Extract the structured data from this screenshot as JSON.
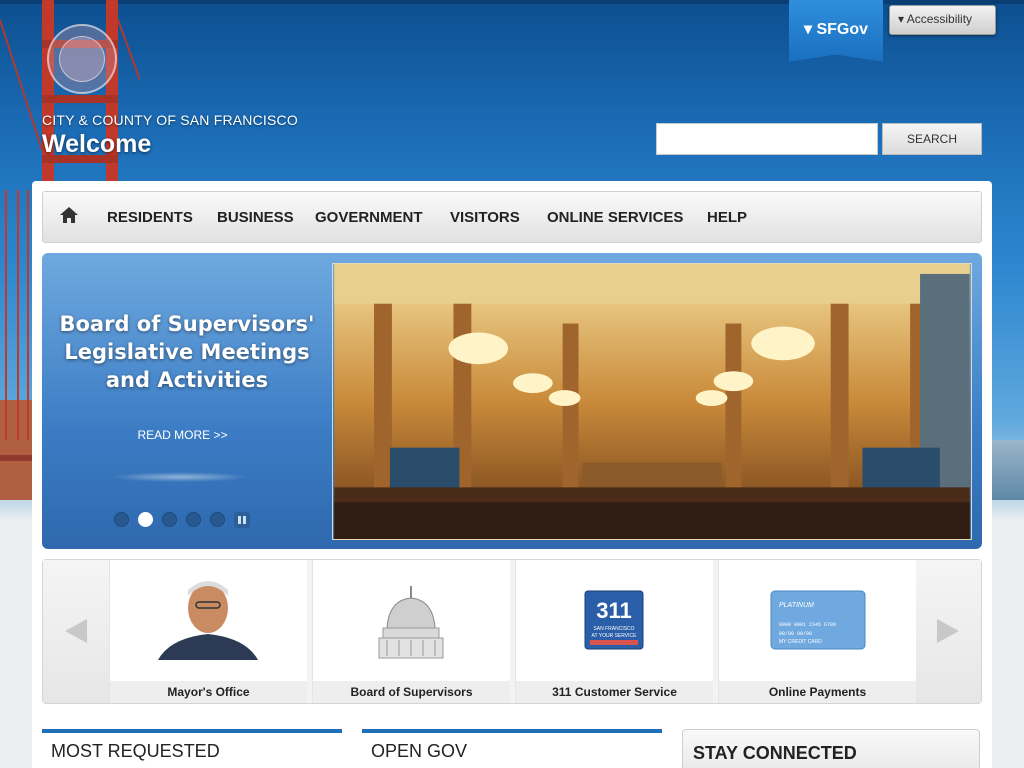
{
  "header": {
    "city_name": "CITY & COUNTY OF SAN FRANCISCO",
    "welcome": "Welcome",
    "sfgov_label": "▾ SFGov",
    "accessibility_label": "▾ Accessibility",
    "search": {
      "value": "",
      "placeholder": "",
      "button_label": "SEARCH"
    }
  },
  "nav": {
    "home_icon": "home-icon",
    "items": [
      "RESIDENTS",
      "BUSINESS",
      "GOVERNMENT",
      "VISITORS",
      "ONLINE SERVICES",
      "HELP"
    ]
  },
  "hero": {
    "title_line1": "Board of Supervisors'",
    "title_line2": "Legislative Meetings",
    "title_line3": "and Activities",
    "read_more": "READ MORE >>",
    "slide_count": 5,
    "active_slide": 2,
    "pause_icon": "pause-icon"
  },
  "quick_links": [
    {
      "label": "Mayor's Office",
      "icon": "mayor-portrait"
    },
    {
      "label": "Board of Supervisors",
      "icon": "city-hall-dome"
    },
    {
      "label": "311 Customer Service",
      "icon": "311-logo"
    },
    {
      "label": "Online Payments",
      "icon": "credit-card"
    }
  ],
  "logo_311": {
    "number": "311",
    "sub1": "SAN FRANCISCO",
    "sub2": "AT YOUR SERVICE"
  },
  "card_text": {
    "brand": "PLATINUM",
    "number": "0000 0001 2345 6789",
    "dates": "00/00   00/00",
    "name": "MY CREDIT CARD"
  },
  "sections": {
    "most_requested": "MOST REQUESTED",
    "open_gov": "OPEN GOV",
    "stay_connected": "STAY CONNECTED"
  },
  "colors": {
    "accent": "#1f6fb8",
    "hero_blue": "#3b7cc4",
    "header_blue": "#0d4f8f"
  }
}
